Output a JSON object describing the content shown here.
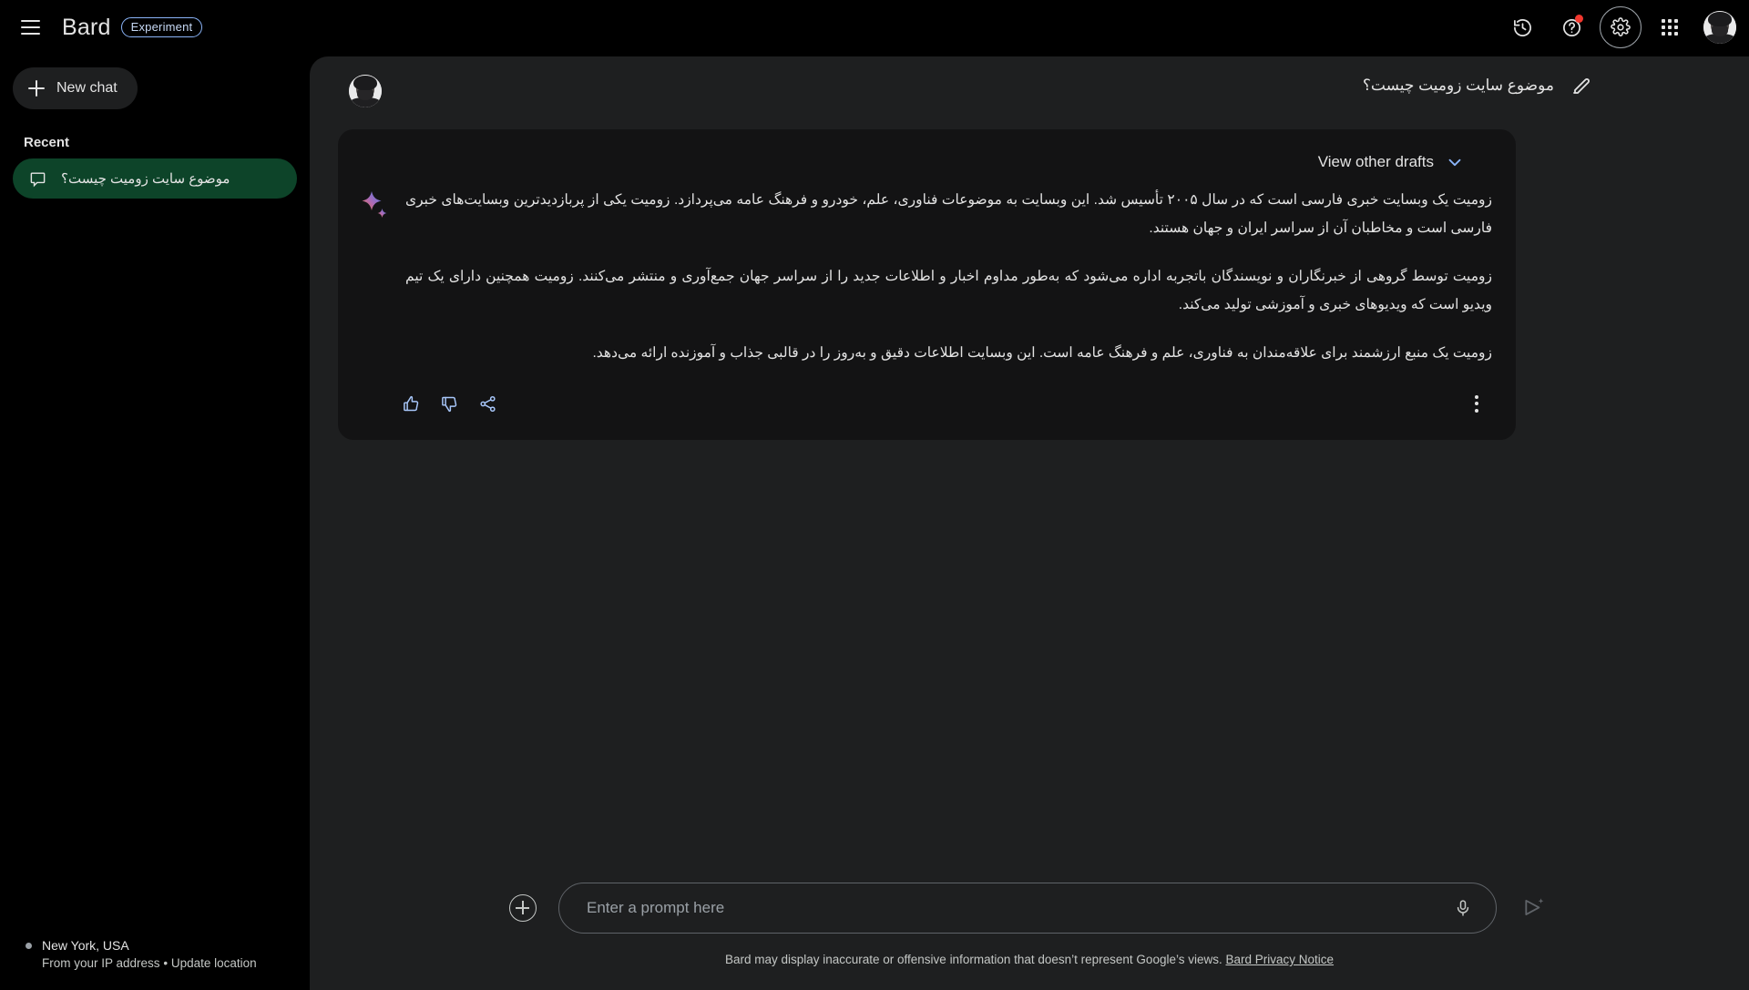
{
  "header": {
    "menu_icon": "hamburger-menu-icon",
    "brand_name": "Bard",
    "badge_label": "Experiment",
    "icons": {
      "history": "history-icon",
      "help": "help-question-icon",
      "settings": "settings-gear-icon",
      "apps": "apps-grid-icon",
      "account": "account-avatar"
    }
  },
  "sidebar": {
    "new_chat_label": "New chat",
    "recent_label": "Recent",
    "items": [
      {
        "label": "موضوع سایت زومیت چیست؟",
        "icon": "chat-bubble-icon",
        "active": true
      }
    ],
    "location": {
      "place": "New York, USA",
      "source_text": "From your IP address",
      "separator": "•",
      "update_link": "Update location"
    }
  },
  "conversation": {
    "prompt_title": "موضوع سایت زومیت چیست؟",
    "edit_icon": "edit-pencil-icon",
    "drafts_label": "View other drafts",
    "drafts_chevron": "chevron-down-icon",
    "sparkle_icon": "bard-sparkle-icon",
    "paragraphs": [
      "زومیت یک وبسایت خبری فارسی است که در سال ۲۰۰۵ تأسیس شد. این وبسایت به موضوعات فناوری، علم، خودرو و فرهنگ عامه می‌پردازد. زومیت یکی از پربازدیدترین وبسایت‌های خبری فارسی است و مخاطبان آن از سراسر ایران و جهان هستند.",
      "زومیت توسط گروهی از خبرنگاران و نویسندگان باتجربه اداره می‌شود که به‌طور مداوم اخبار و اطلاعات جدید را از سراسر جهان جمع‌آوری و منتشر می‌کنند. زومیت همچنین دارای یک تیم ویدیو است که ویدیوهای خبری و آموزشی تولید می‌کند.",
      "زومیت یک منبع ارزشمند برای علاقه‌مندان به فناوری، علم و فرهنگ عامه است. این وبسایت اطلاعات دقیق و به‌روز را در قالبی جذاب و آموزنده ارائه می‌دهد."
    ],
    "actions": {
      "thumbs_up": "thumbs-up-icon",
      "thumbs_down": "thumbs-down-icon",
      "share": "share-icon",
      "more": "more-vertical-icon"
    }
  },
  "input": {
    "add_icon": "plus-circle-icon",
    "placeholder": "Enter a prompt here",
    "value": "",
    "mic_icon": "microphone-icon",
    "send_icon": "send-sparkle-icon"
  },
  "footer": {
    "disclaimer": "Bard may display inaccurate or offensive information that doesn’t represent Google’s views.",
    "privacy_link": "Bard Privacy Notice"
  },
  "colors": {
    "background": "#000000",
    "panel": "#1e1f20",
    "card": "#131314",
    "accent_green": "#0d4429",
    "accent_blue": "#8ab4f8",
    "text": "#e3e3e3"
  }
}
